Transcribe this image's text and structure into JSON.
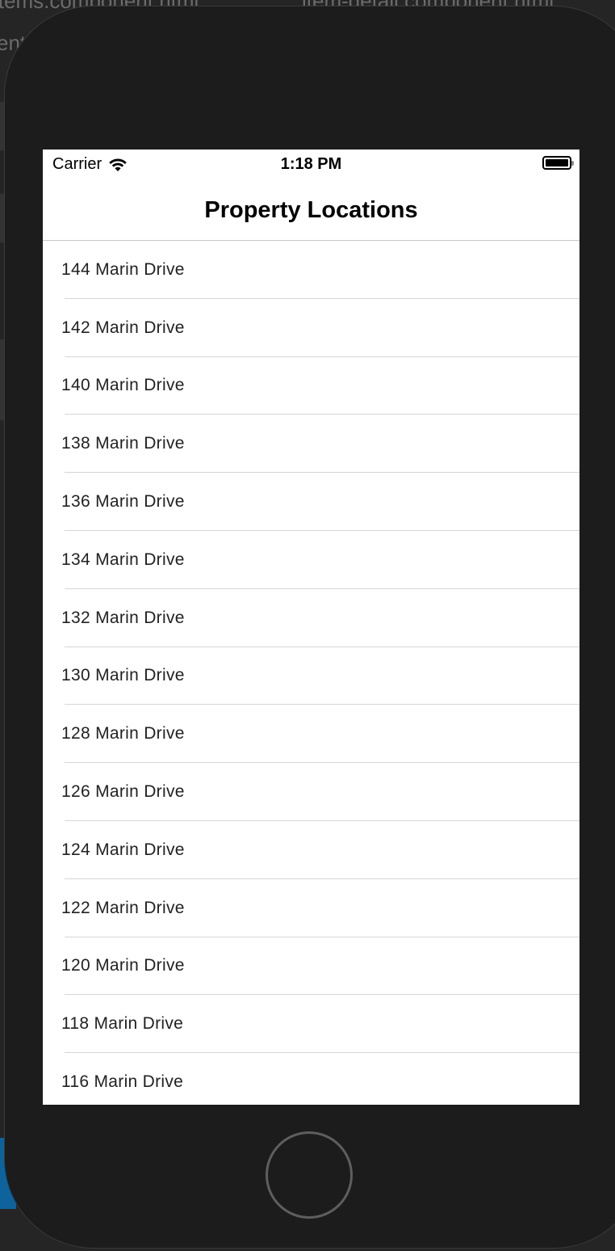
{
  "backdrop": {
    "tab_left": "items.component.html",
    "tab_right": "item-detail.component.html",
    "fragment": "ent"
  },
  "status_bar": {
    "carrier": "Carrier",
    "time": "1:18 PM"
  },
  "nav": {
    "title": "Property Locations"
  },
  "locations": [
    "144 Marin Drive",
    "142 Marin Drive",
    "140 Marin Drive",
    "138 Marin Drive",
    "136 Marin Drive",
    "134 Marin Drive",
    "132 Marin Drive",
    "130 Marin Drive",
    "128 Marin Drive",
    "126 Marin Drive",
    "124 Marin Drive",
    "122 Marin Drive",
    "120 Marin Drive",
    "118 Marin Drive",
    "116 Marin Drive"
  ],
  "colors": {
    "device_frame": "#1c1c1c",
    "screen_background": "#ffffff",
    "separator": "#d6d5d9"
  }
}
